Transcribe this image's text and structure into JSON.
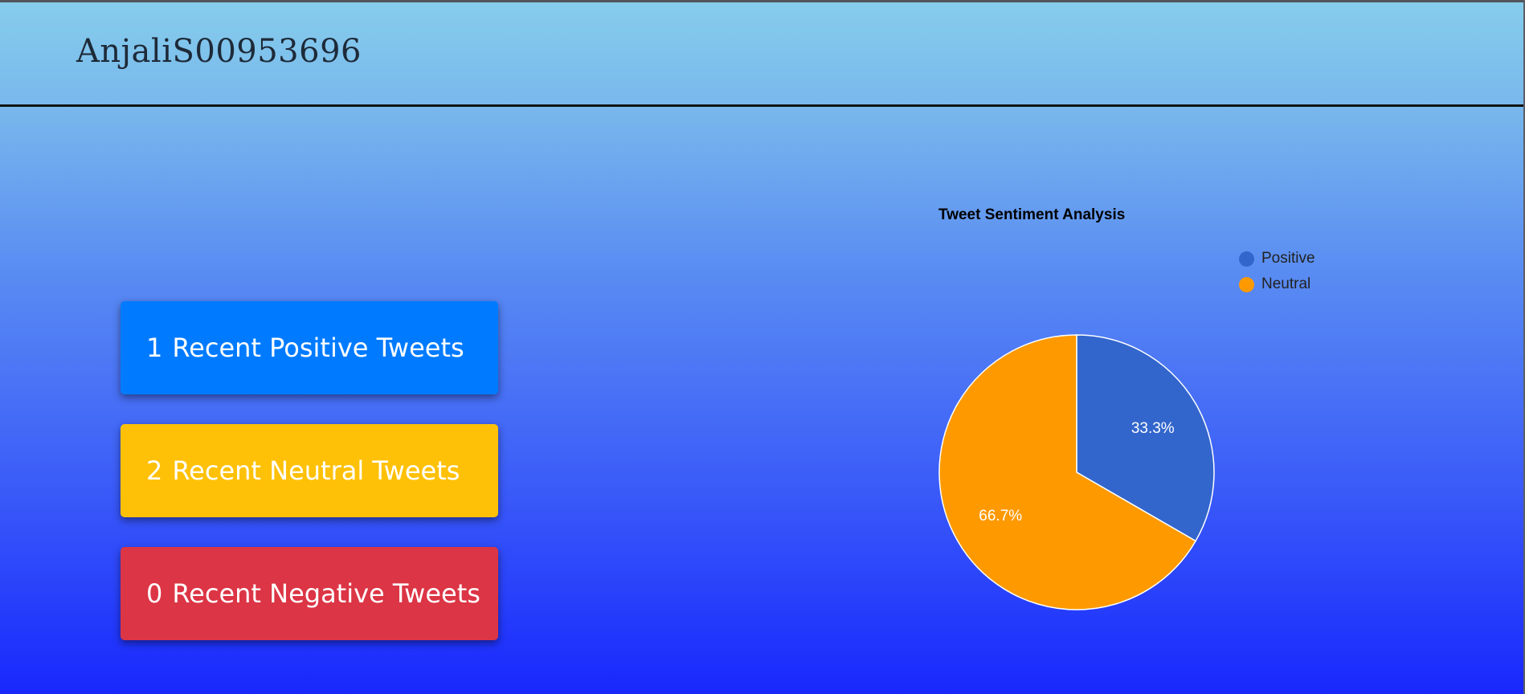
{
  "header": {
    "username": "AnjaliS00953696"
  },
  "stats": {
    "positive": {
      "count": "1",
      "label": "Recent Positive Tweets",
      "color": "#007bff"
    },
    "neutral": {
      "count": "2",
      "label": "Recent Neutral Tweets",
      "color": "#ffc107"
    },
    "negative": {
      "count": "0",
      "label": "Recent Negative Tweets",
      "color": "#dc3545"
    }
  },
  "chart_data": {
    "type": "pie",
    "title": "Tweet Sentiment Analysis",
    "categories": [
      "Positive",
      "Neutral"
    ],
    "values": [
      1,
      2
    ],
    "percent_labels": [
      "33.3%",
      "66.7%"
    ],
    "colors": [
      "#3366cc",
      "#ff9900"
    ],
    "legend_position": "top-right"
  }
}
